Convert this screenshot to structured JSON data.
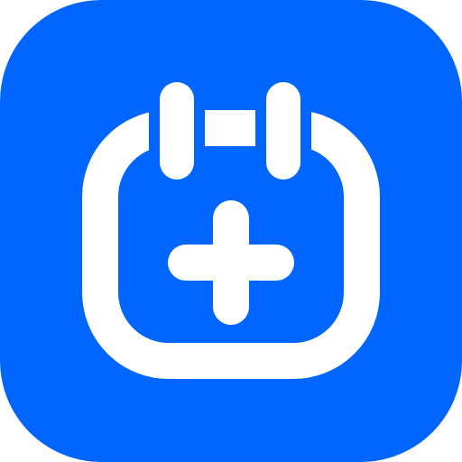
{
  "icon": {
    "name": "calendar-add-icon",
    "glyph": "calendar-plus",
    "background_color": "#0066FF",
    "foreground_color": "#FFFFFF"
  }
}
